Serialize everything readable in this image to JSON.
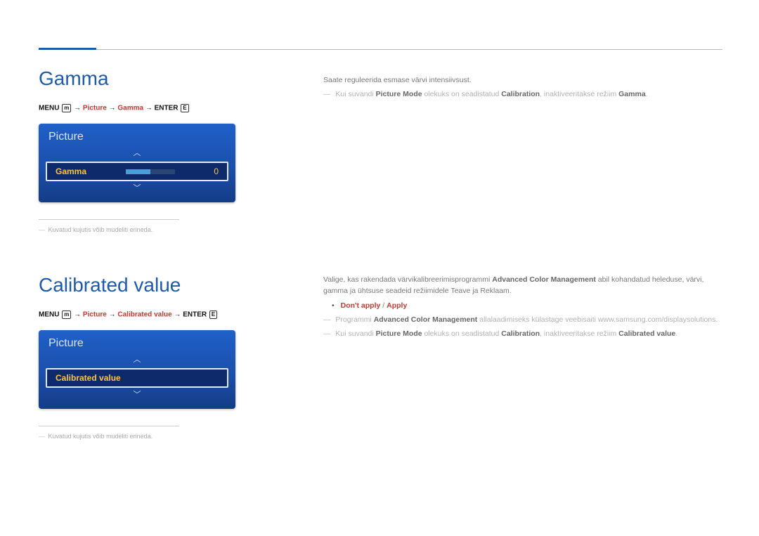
{
  "section1": {
    "heading": "Gamma",
    "breadcrumb": {
      "pre": "MENU",
      "menu_icon": "m",
      "arrow": "→",
      "path1": "Picture",
      "path2": "Gamma",
      "post": "ENTER",
      "enter_icon": "E"
    },
    "osd": {
      "header": "Picture",
      "label": "Gamma",
      "value": "0"
    },
    "footnote": "Kuvatud kujutis võib mudeliti erineda.",
    "right": {
      "line1": "Saate reguleerida esmase värvi intensiivsust.",
      "note_pre": "Kui suvandi",
      "note_pm": "Picture Mode",
      "note_mid": "olekuks on seadistatud",
      "note_cal": "Calibration",
      "note_post": ", inaktiveeritakse režiim",
      "note_gamma": "Gamma",
      "note_end": "."
    }
  },
  "section2": {
    "heading": "Calibrated value",
    "breadcrumb": {
      "pre": "MENU",
      "menu_icon": "m",
      "arrow": "→",
      "path1": "Picture",
      "path2": "Calibrated value",
      "post": "ENTER",
      "enter_icon": "E"
    },
    "osd": {
      "header": "Picture",
      "label": "Calibrated value"
    },
    "footnote": "Kuvatud kujutis võib mudeliti erineda.",
    "right": {
      "p1a": "Valige, kas rakendada värvikalibreerimisprogrammi",
      "p1b": "Advanced Color Management",
      "p1c": "abil kohandatud heleduse, värvi, gamma ja ühtsuse seadeid režiimidele Teave ja Reklaam.",
      "options_a": "Don't apply",
      "options_sep": "/",
      "options_b": "Apply",
      "n1a": "Programmi",
      "n1b": "Advanced Color Management",
      "n1c": "allalaadimiseks külastage veebisaiti www.samsung.com/displaysolutions.",
      "n2a": "Kui suvandi",
      "n2b": "Picture Mode",
      "n2c": "olekuks on seadistatud",
      "n2d": "Calibration",
      "n2e": ", inaktiveeritakse režiim",
      "n2f": "Calibrated value",
      "n2g": "."
    }
  }
}
